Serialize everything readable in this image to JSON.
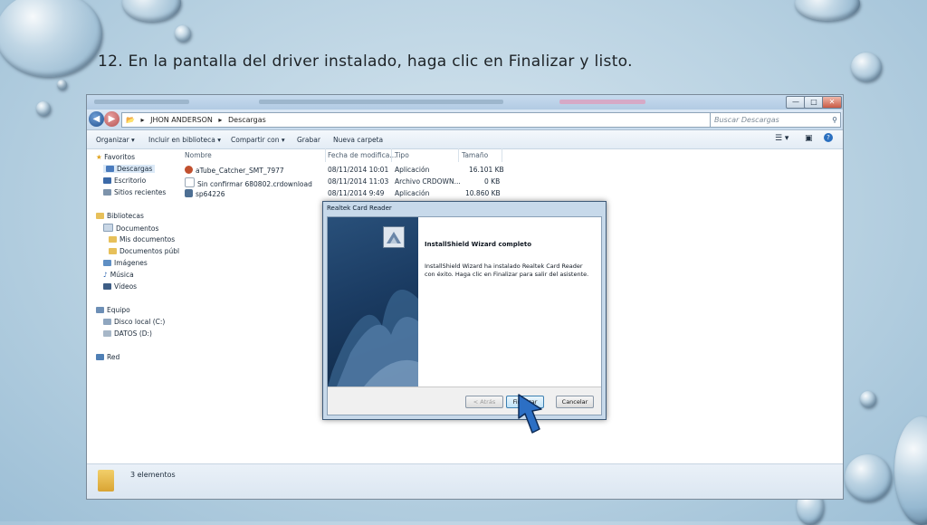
{
  "slide": {
    "title": "12. En la pantalla del driver instalado, haga clic en Finalizar y listo."
  },
  "explorer": {
    "address_segments": [
      "JHON ANDERSON",
      "Descargas"
    ],
    "search_placeholder": "Buscar Descargas",
    "toolbar": [
      "Organizar ▾",
      "Incluir en biblioteca ▾",
      "Compartir con ▾",
      "Grabar",
      "Nueva carpeta"
    ],
    "sidebar": {
      "favorites_header": "Favoritos",
      "favorites": [
        "Descargas",
        "Escritorio",
        "Sitios recientes"
      ],
      "libraries_header": "Bibliotecas",
      "libraries": [
        "Documentos",
        "Mis documentos",
        "Documentos públ",
        "Imágenes",
        "Música",
        "Vídeos"
      ],
      "computer_header": "Equipo",
      "drives": [
        "Disco local (C:)",
        "DATOS (D:)"
      ],
      "network": "Red"
    },
    "columns": [
      "Nombre",
      "Fecha de modifica...",
      "Tipo",
      "Tamaño"
    ],
    "files": [
      {
        "name": "aTube_Catcher_SMT_7977",
        "date": "08/11/2014 10:01",
        "type": "Aplicación",
        "size": "16.101 KB"
      },
      {
        "name": "Sin confirmar 680802.crdownload",
        "date": "08/11/2014 11:03",
        "type": "Archivo CRDOWN...",
        "size": "0 KB"
      },
      {
        "name": "sp64226",
        "date": "08/11/2014 9:49",
        "type": "Aplicación",
        "size": "10.860 KB"
      }
    ],
    "status": "3 elementos"
  },
  "wizard": {
    "title": "Realtek Card Reader",
    "heading": "InstallShield Wizard completo",
    "message": "InstallShield Wizard ha instalado Realtek Card Reader con éxito. Haga clic en Finalizar para salir del asistente.",
    "buttons": {
      "back": "< Atrás",
      "finish": "Finalizar",
      "cancel": "Cancelar"
    }
  },
  "colors": {
    "arrow": "#2c6fc4",
    "accent": "#3c7fb1"
  }
}
